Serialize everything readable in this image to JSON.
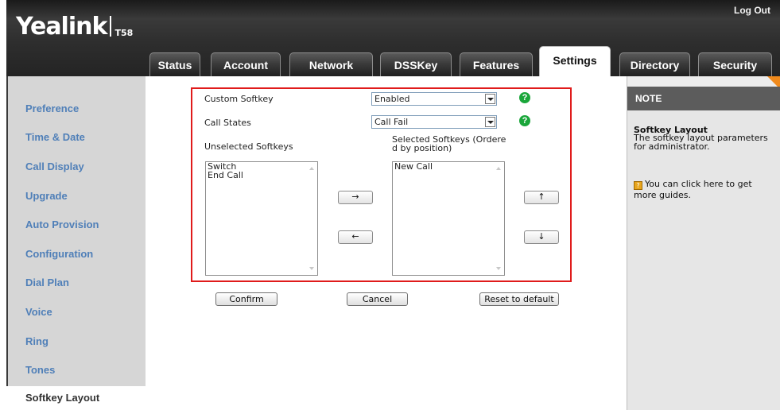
{
  "header": {
    "logo_text": "Yealink",
    "model": "T58",
    "logout_label": "Log Out"
  },
  "tabs": [
    {
      "label": "Status",
      "active": false
    },
    {
      "label": "Account",
      "active": false
    },
    {
      "label": "Network",
      "active": false
    },
    {
      "label": "DSSKey",
      "active": false
    },
    {
      "label": "Features",
      "active": false
    },
    {
      "label": "Settings",
      "active": true
    },
    {
      "label": "Directory",
      "active": false
    },
    {
      "label": "Security",
      "active": false
    }
  ],
  "sidebar": {
    "items": [
      {
        "label": "Preference"
      },
      {
        "label": "Time & Date"
      },
      {
        "label": "Call Display"
      },
      {
        "label": "Upgrade"
      },
      {
        "label": "Auto Provision"
      },
      {
        "label": "Configuration"
      },
      {
        "label": "Dial Plan"
      },
      {
        "label": "Voice"
      },
      {
        "label": "Ring"
      },
      {
        "label": "Tones"
      },
      {
        "label": "Softkey Layout",
        "active": true
      }
    ]
  },
  "form": {
    "custom_softkey_label": "Custom Softkey",
    "custom_softkey_value": "Enabled",
    "call_states_label": "Call States",
    "call_states_value": "Call Fail",
    "unselected_label": "Unselected Softkeys",
    "selected_label_line1": "Selected Softkeys (Ordere",
    "selected_label_line2": "d by position)",
    "unselected_items": [
      "Switch",
      "End Call"
    ],
    "selected_items": [
      "New Call"
    ],
    "move_right_label": "→",
    "move_left_label": "←",
    "move_up_label": "↑",
    "move_down_label": "↓"
  },
  "buttons": {
    "confirm": "Confirm",
    "cancel": "Cancel",
    "reset": "Reset to default"
  },
  "note": {
    "head": "NOTE",
    "title": "Softkey Layout",
    "description": "The softkey layout parameters for administrator.",
    "guide_text": "You can click here to get more guides."
  },
  "colors": {
    "highlight_border": "#e01b1b",
    "sidebar_link": "#4f7fb8",
    "help_icon": "#1aa63a",
    "note_corner": "#f08a1c"
  }
}
